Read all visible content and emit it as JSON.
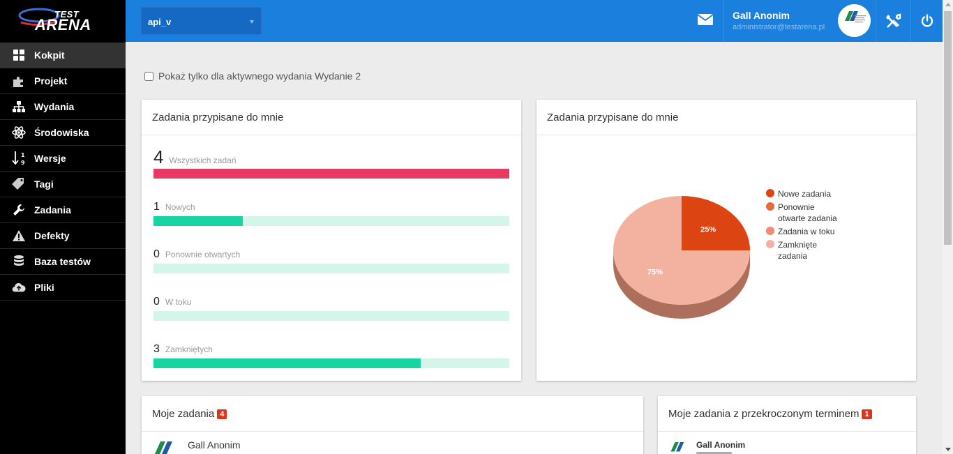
{
  "app": {
    "logo_top": "TEST",
    "logo_bottom": "ARENA"
  },
  "sidebar": {
    "items": [
      {
        "label": "Kokpit",
        "icon": "dashboard-icon",
        "active": true
      },
      {
        "label": "Projekt",
        "icon": "puzzle-icon"
      },
      {
        "label": "Wydania",
        "icon": "sitemap-icon"
      },
      {
        "label": "Środowiska",
        "icon": "atom-icon"
      },
      {
        "label": "Wersje",
        "icon": "sort-numeric-icon"
      },
      {
        "label": "Tagi",
        "icon": "tag-icon"
      },
      {
        "label": "Zadania",
        "icon": "wrench-icon"
      },
      {
        "label": "Defekty",
        "icon": "warning-icon"
      },
      {
        "label": "Baza testów",
        "icon": "database-icon"
      },
      {
        "label": "Pliki",
        "icon": "cloud-upload-icon"
      }
    ]
  },
  "header": {
    "project": "api_v",
    "user_name": "Gall Anonim",
    "user_email": "administrator@testarena.pl"
  },
  "filter": {
    "label": "Pokaż tylko dla aktywnego wydania Wydanie 2",
    "checked": false
  },
  "stats_panel": {
    "title": "Zadania przypisane do mnie",
    "total": {
      "count": "4",
      "label": "Wszystkich zadań",
      "fraction": 1.0
    },
    "rows": [
      {
        "count": "1",
        "label": "Nowych",
        "fraction": 0.25
      },
      {
        "count": "0",
        "label": "Ponownie otwartych",
        "fraction": 0
      },
      {
        "count": "0",
        "label": "W toku",
        "fraction": 0
      },
      {
        "count": "3",
        "label": "Zamkniętych",
        "fraction": 0.75
      }
    ]
  },
  "chart_panel": {
    "title": "Zadania przypisane do mnie"
  },
  "chart_data": {
    "type": "pie",
    "slices": [
      {
        "label": "Nowe zadania",
        "value": 25,
        "color": "#dc4511"
      },
      {
        "label": "Ponownie otwarte zadania",
        "value": 0,
        "color": "#e6693f"
      },
      {
        "label": "Zadania w toku",
        "value": 0,
        "color": "#ec8d6f"
      },
      {
        "label": "Zamknięte zadania",
        "value": 75,
        "color": "#f2b29f"
      }
    ],
    "data_labels": [
      "25%",
      "75%"
    ],
    "legend_position": "right"
  },
  "tasks_panel": {
    "title": "Moje zadania",
    "badge": "4",
    "first_user": "Gall Anonim"
  },
  "overdue_panel": {
    "title": "Moje zadania z przekroczonym terminem",
    "badge": "1",
    "first_user": "Gall Anonim"
  },
  "colors": {
    "header": "#1a7fdd",
    "sidebar": "#000000",
    "bar_fill": "#17d4a2",
    "bar_track": "#d3f5ea",
    "total_bar": "#e83a62",
    "badge": "#e0331c"
  }
}
